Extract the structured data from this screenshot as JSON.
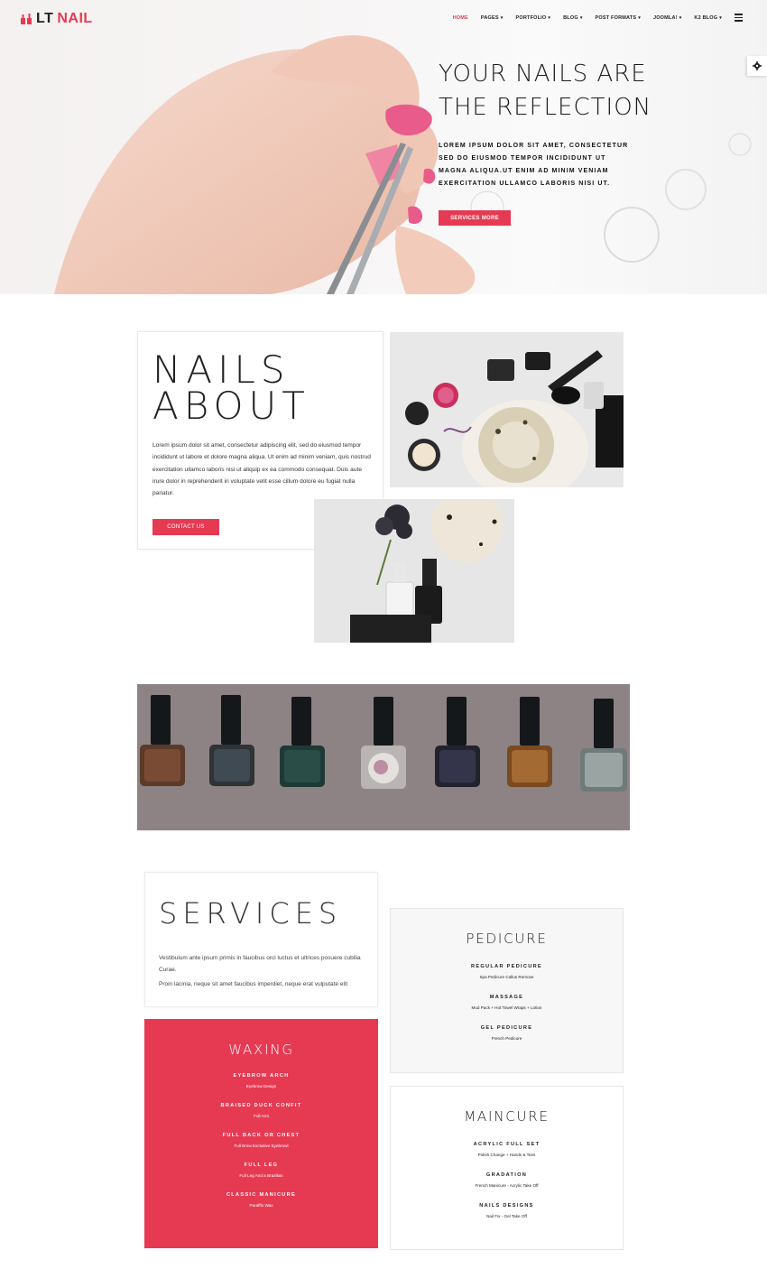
{
  "brand": {
    "lt": "LT",
    "nail": "NAIL",
    "accent_color": "#e63a53"
  },
  "nav": {
    "items": [
      {
        "label": "HOME",
        "active": true,
        "dropdown": false
      },
      {
        "label": "PAGES",
        "active": false,
        "dropdown": true
      },
      {
        "label": "PORTFOLIO",
        "active": false,
        "dropdown": true
      },
      {
        "label": "BLOG",
        "active": false,
        "dropdown": true
      },
      {
        "label": "POST FORMATS",
        "active": false,
        "dropdown": true
      },
      {
        "label": "JOOMLA!",
        "active": false,
        "dropdown": true
      },
      {
        "label": "K2 BLOG",
        "active": false,
        "dropdown": true
      }
    ],
    "caret": "▾",
    "menu_icon": "hamburger-icon",
    "settings_icon": "gear-icon"
  },
  "hero": {
    "title_line1": "YOUR NAILS ARE",
    "title_line2": "THE REFLECTION",
    "text": "LOREM IPSUM DOLOR SIT AMET, CONSECTETUR SED DO EIUSMOD TEMPOR INCIDIDUNT UT MAGNA ALIQUA.UT ENIM AD MINIM VENIAM EXERCITATION ULLAMCO LABORIS NISI UT.",
    "button": "SERVICES MORE"
  },
  "about": {
    "title_line1": "NAILS",
    "title_line2": "ABOUT",
    "text": "Lorem ipsum dolor sit amet, consectetur adipiscing elit, sed do eiusmod tempor incididunt ut labore et dolore magna aliqua. Ut enim ad minim veniam, quis nostrud exercitation ullamco laboris nisi ut aliquip ex ea commodo consequat. Duis aute irure dolor in reprehenderit in voluptate velit esse cillum dolore eu fugiat nulla pariatur.",
    "button": "CONTACT US"
  },
  "services": {
    "title": "SERVICES",
    "paragraph1": "Vestibulum ante ipsum primis in faucibus orci luctus et ultrices posuere cubilia Curae.",
    "paragraph2": "Proin lacinia, neque sit amet faucibus imperdiet, neque erat vulputate elit"
  },
  "waxing": {
    "title": "WAXING",
    "items": [
      {
        "name": "EYEBROW ARCH",
        "desc": "Eyebrow Design"
      },
      {
        "name": "BRAISED DUCK CONFIT",
        "desc": "Full Arm"
      },
      {
        "name": "FULL BACK OR CHEST",
        "desc": "Full Brow Exclusive Eyebrowl"
      },
      {
        "name": "FULL LEG",
        "desc": "Full Leg And a Brazilian"
      },
      {
        "name": "CLASSIC MANICURE",
        "desc": "Paraffin Wax"
      }
    ]
  },
  "pedicure": {
    "title": "PEDICURE",
    "items": [
      {
        "name": "REGULAR PEDICURE",
        "desc": "Spa Pedicure Callus Remove"
      },
      {
        "name": "MASSAGE",
        "desc": "Mud Pack + Hot Towel Wraps + Lotion"
      },
      {
        "name": "GEL PEDICURE",
        "desc": "French Pedicure"
      }
    ]
  },
  "maincure": {
    "title": "MAINCURE",
    "items": [
      {
        "name": "ACRYLIC FULL SET",
        "desc": "Polish Change + Hands & Toes"
      },
      {
        "name": "GRADATION",
        "desc": "French Manicure - Acrylic Take Off"
      },
      {
        "name": "NAILS DESIGNS",
        "desc": "Nail Fix - Gel Take Off"
      }
    ]
  }
}
